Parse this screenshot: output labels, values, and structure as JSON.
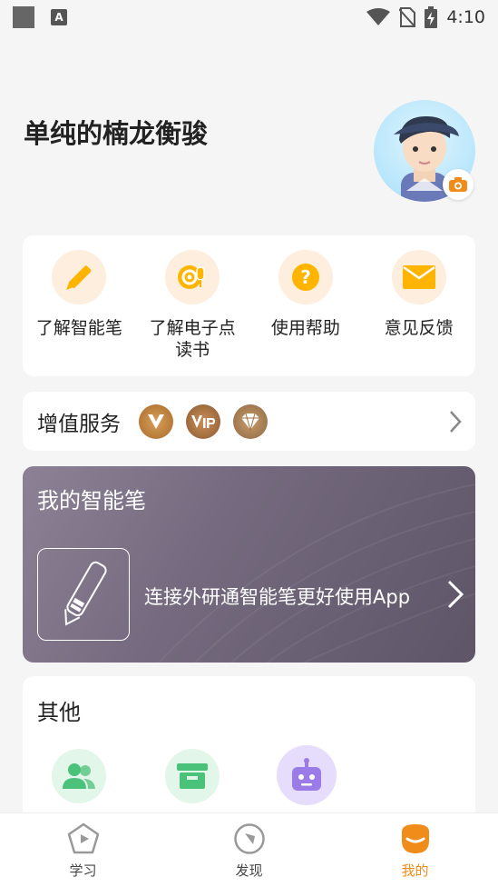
{
  "status_bar": {
    "a_icon_text": "A",
    "time": "4:10",
    "icons": [
      "gallery-icon",
      "a-icon",
      "wifi-icon",
      "no-sim-icon",
      "battery-charging-icon"
    ]
  },
  "profile": {
    "username": "单纯的楠龙衡骏",
    "avatar_icon": "avatar-icon",
    "camera_icon": "camera-icon"
  },
  "quick_actions": [
    {
      "label": "了解智能笔",
      "icon": "pen-icon"
    },
    {
      "label": "了解电子点读书",
      "icon": "audio-book-icon"
    },
    {
      "label": "使用帮助",
      "icon": "question-icon"
    },
    {
      "label": "意见反馈",
      "icon": "mail-icon"
    }
  ],
  "value_services": {
    "title": "增值服务",
    "badges": [
      "v-badge-icon",
      "vip-badge-icon",
      "diamond-badge-icon"
    ]
  },
  "smart_pen": {
    "title": "我的智能笔",
    "connect_text": "连接外研通智能笔更好使用App"
  },
  "other": {
    "title": "其他",
    "icons": [
      "users-icon",
      "box-icon",
      "robot-icon"
    ]
  },
  "tabs": [
    {
      "label": "学习",
      "icon": "study-icon"
    },
    {
      "label": "发现",
      "icon": "discover-icon"
    },
    {
      "label": "我的",
      "icon": "profile-icon"
    }
  ],
  "colors": {
    "accent": "#f08c19",
    "icon_yellow": "#ffb400",
    "pen_card": "#756a7f",
    "green": "#4bc27a",
    "purple": "#9b7be8"
  }
}
